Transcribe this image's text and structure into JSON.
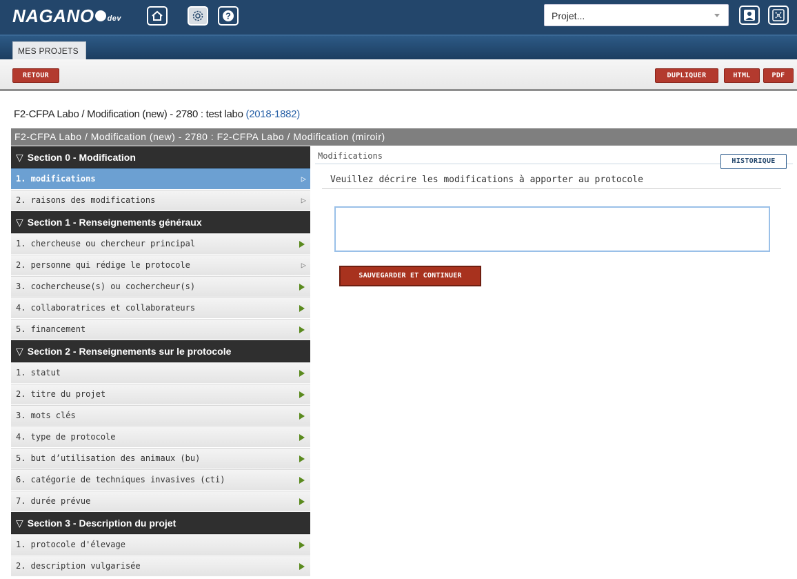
{
  "header": {
    "logo": "NAGANO",
    "logo_suffix": "dev",
    "project_select": {
      "value": "Projet..."
    }
  },
  "tabs": [
    {
      "label": "MES PROJETS"
    }
  ],
  "toolbar": {
    "back_label": "RETOUR",
    "duplicate_label": "DUPLIQUER",
    "html_label": "HTML",
    "pdf_label": "PDF"
  },
  "page": {
    "title": "F2-CFPA Labo / Modification (new) - 2780 : test labo",
    "year_ref": "(2018-1882)",
    "form_header": "F2-CFPA Labo / Modification (new) - 2780 : F2-CFPA Labo / Modification (miroir)"
  },
  "sidebar": {
    "sections": [
      {
        "title": "Section 0 - Modification",
        "items": [
          {
            "label": "1. modifications",
            "status": "selected"
          },
          {
            "label": "2. raisons des modifications",
            "status": "incomplete"
          }
        ]
      },
      {
        "title": "Section 1 - Renseignements généraux",
        "items": [
          {
            "label": "1. chercheuse ou chercheur principal",
            "status": "complete"
          },
          {
            "label": "2. personne qui rédige le protocole",
            "status": "incomplete"
          },
          {
            "label": "3. cochercheuse(s) ou cochercheur(s)",
            "status": "complete"
          },
          {
            "label": "4. collaboratrices et collaborateurs",
            "status": "complete"
          },
          {
            "label": "5. financement",
            "status": "complete"
          }
        ]
      },
      {
        "title": "Section 2 - Renseignements sur le protocole",
        "items": [
          {
            "label": "1. statut",
            "status": "complete"
          },
          {
            "label": "2. titre du projet",
            "status": "complete"
          },
          {
            "label": "3. mots clés",
            "status": "complete"
          },
          {
            "label": "4. type de protocole",
            "status": "complete"
          },
          {
            "label": "5. but d’utilisation des animaux (bu)",
            "status": "complete"
          },
          {
            "label": "6. catégorie de techniques invasives (cti)",
            "status": "complete"
          },
          {
            "label": "7. durée prévue",
            "status": "complete"
          }
        ]
      },
      {
        "title": "Section 3 - Description du projet",
        "items": [
          {
            "label": "1. protocole d'élevage",
            "status": "complete"
          },
          {
            "label": "2. description vulgarisée",
            "status": "complete"
          }
        ]
      }
    ]
  },
  "main": {
    "panel_label": "Modifications",
    "history_label": "HISTORIQUE",
    "question": "Veuillez décrire les modifications à apporter au protocole",
    "answer_value": "",
    "save_label": "SAUVEGARDER ET CONTINUER"
  },
  "colors": {
    "header_bg": "#23466b",
    "accent_red": "#b33a2e",
    "selected_blue": "#6ca0d2",
    "complete_arrow": "#5a8a1e",
    "section_bg": "#2f2f2f"
  }
}
